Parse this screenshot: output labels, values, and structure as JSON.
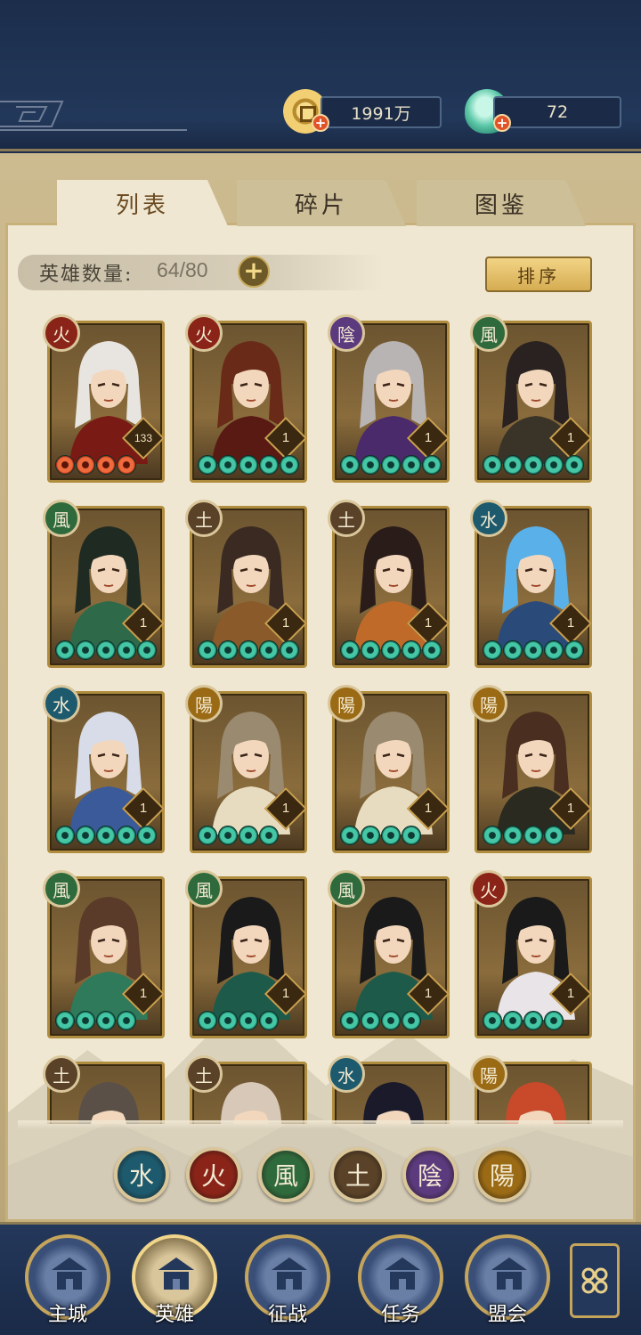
{
  "resources": {
    "coin": "1991万",
    "jade": "72"
  },
  "tabs": [
    {
      "label": "列表",
      "active": true
    },
    {
      "label": "碎片",
      "active": false
    },
    {
      "label": "图鉴",
      "active": false
    }
  ],
  "hero_count": {
    "label": "英雄数量:",
    "value": "64/80"
  },
  "sort_label": "排序",
  "elements": {
    "fire": {
      "glyph": "火",
      "color": "#8b2418"
    },
    "water": {
      "glyph": "水",
      "color": "#1d5a6e"
    },
    "wind": {
      "glyph": "風",
      "color": "#2f6a3c"
    },
    "earth": {
      "glyph": "土",
      "color": "#5a4228"
    },
    "yin": {
      "glyph": "陰",
      "color": "#5c3a7e"
    },
    "yang": {
      "glyph": "陽",
      "color": "#9a6a14"
    }
  },
  "heroes": [
    {
      "element": "fire",
      "level": "133",
      "stars": 4,
      "star_color": "red",
      "hair": "#e8e4df",
      "cloth": "#7a1a14"
    },
    {
      "element": "fire",
      "level": "1",
      "stars": 5,
      "star_color": "green",
      "hair": "#6a2a18",
      "cloth": "#5a1a14"
    },
    {
      "element": "yin",
      "level": "1",
      "stars": 5,
      "star_color": "green",
      "hair": "#b8b4b4",
      "cloth": "#4a2a6a"
    },
    {
      "element": "wind",
      "level": "1",
      "stars": 5,
      "star_color": "green",
      "hair": "#2a2220",
      "cloth": "#3a3428"
    },
    {
      "element": "wind",
      "level": "1",
      "stars": 5,
      "star_color": "green",
      "hair": "#1e2a22",
      "cloth": "#2e6a4a"
    },
    {
      "element": "earth",
      "level": "1",
      "stars": 5,
      "star_color": "green",
      "hair": "#3a2a22",
      "cloth": "#8a5a2a"
    },
    {
      "element": "earth",
      "level": "1",
      "stars": 5,
      "star_color": "green",
      "hair": "#2a1c18",
      "cloth": "#c06a2a"
    },
    {
      "element": "water",
      "level": "1",
      "stars": 5,
      "star_color": "green",
      "hair": "#5ab0e8",
      "cloth": "#2a4a7a"
    },
    {
      "element": "water",
      "level": "1",
      "stars": 5,
      "star_color": "green",
      "hair": "#d8dce8",
      "cloth": "#3a5a9a"
    },
    {
      "element": "yang",
      "level": "1",
      "stars": 4,
      "star_color": "green",
      "hair": "#9a8a70",
      "cloth": "#e8dcc0"
    },
    {
      "element": "yang",
      "level": "1",
      "stars": 4,
      "star_color": "green",
      "hair": "#9a8a70",
      "cloth": "#e8dcc0"
    },
    {
      "element": "yang",
      "level": "1",
      "stars": 4,
      "star_color": "green",
      "hair": "#4a2e20",
      "cloth": "#2a2a20"
    },
    {
      "element": "wind",
      "level": "1",
      "stars": 4,
      "star_color": "green",
      "hair": "#5a3a28",
      "cloth": "#2e7a5a"
    },
    {
      "element": "wind",
      "level": "1",
      "stars": 4,
      "star_color": "green",
      "hair": "#1a1a1a",
      "cloth": "#1e5a4a"
    },
    {
      "element": "wind",
      "level": "1",
      "stars": 4,
      "star_color": "green",
      "hair": "#1a1a1a",
      "cloth": "#1e5a4a"
    },
    {
      "element": "fire",
      "level": "1",
      "stars": 4,
      "star_color": "green",
      "hair": "#1a1a1a",
      "cloth": "#e8e4e8"
    },
    {
      "element": "earth",
      "level": "",
      "stars": 0,
      "star_color": "green",
      "hair": "#5a5048",
      "cloth": "#3a3a2a"
    },
    {
      "element": "earth",
      "level": "",
      "stars": 0,
      "star_color": "green",
      "hair": "#d8c8b8",
      "cloth": "#8a6a8a"
    },
    {
      "element": "water",
      "level": "",
      "stars": 0,
      "star_color": "green",
      "hair": "#1a1a2a",
      "cloth": "#2a3a6a"
    },
    {
      "element": "yang",
      "level": "",
      "stars": 0,
      "star_color": "green",
      "hair": "#c84a2a",
      "cloth": "#8a2a1a"
    }
  ],
  "filters": [
    "water",
    "fire",
    "wind",
    "earth",
    "yin",
    "yang"
  ],
  "nav": [
    {
      "label": "主城",
      "icon": "city-gate-icon",
      "active": false
    },
    {
      "label": "英雄",
      "icon": "hero-portrait-icon",
      "active": true
    },
    {
      "label": "征战",
      "icon": "battle-drum-icon",
      "active": false
    },
    {
      "label": "任务",
      "icon": "scroll-bell-icon",
      "active": false
    },
    {
      "label": "盟会",
      "icon": "pavilion-icon",
      "active": false
    }
  ]
}
